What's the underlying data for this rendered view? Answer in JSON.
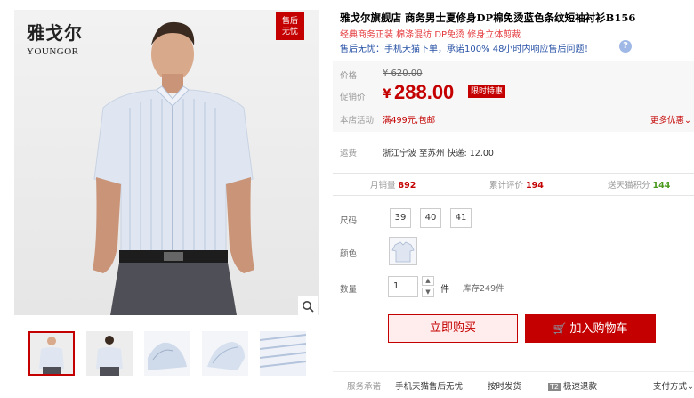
{
  "gallery": {
    "brand_cn": "雅戈尔",
    "brand_en": "YOUNGOR",
    "badge": "售后无忧",
    "thumbnails": [
      "model-front",
      "model-back",
      "collar-detail",
      "fabric-detail",
      "stripe-detail"
    ]
  },
  "product": {
    "title": "雅戈尔旗舰店 商务男士夏修身DP棉免烫蓝色条纹短袖衬衫B156",
    "promo": "经典商务正装  棉涤混纺  DP免烫  修身立体剪裁",
    "service": "售后无忧：手机天猫下单，承诺100% 48小时内响应售后问题！"
  },
  "price": {
    "label_price": "价格",
    "old": "¥ 620.00",
    "label_promo": "促销价",
    "symbol": "¥",
    "current": "288.00",
    "badge": "限时特惠",
    "label_activity": "本店活动",
    "activity": "满499元,包邮",
    "more": "更多优惠"
  },
  "shipping": {
    "label": "运费",
    "text": "浙江宁波  至苏州  快递: 12.00"
  },
  "stats": {
    "monthly_label": "月销量",
    "monthly_value": "892",
    "reviews_label": "累计评价",
    "reviews_value": "194",
    "points_label": "送天猫积分",
    "points_value": "144"
  },
  "options": {
    "size_label": "尺码",
    "sizes": [
      "39",
      "40",
      "41"
    ],
    "color_label": "颜色",
    "qty_label": "数量",
    "qty_value": "1",
    "qty_unit": "件",
    "stock": "库存249件"
  },
  "actions": {
    "buy_now": "立即购买",
    "add_cart": "加入购物车"
  },
  "guarantee": {
    "label": "服务承诺",
    "items": [
      "手机天猫售后无忧",
      "按时发货",
      "极速退款",
      "支付方式"
    ]
  },
  "colors": {
    "accent": "#c40000",
    "link": "#2953a6"
  }
}
